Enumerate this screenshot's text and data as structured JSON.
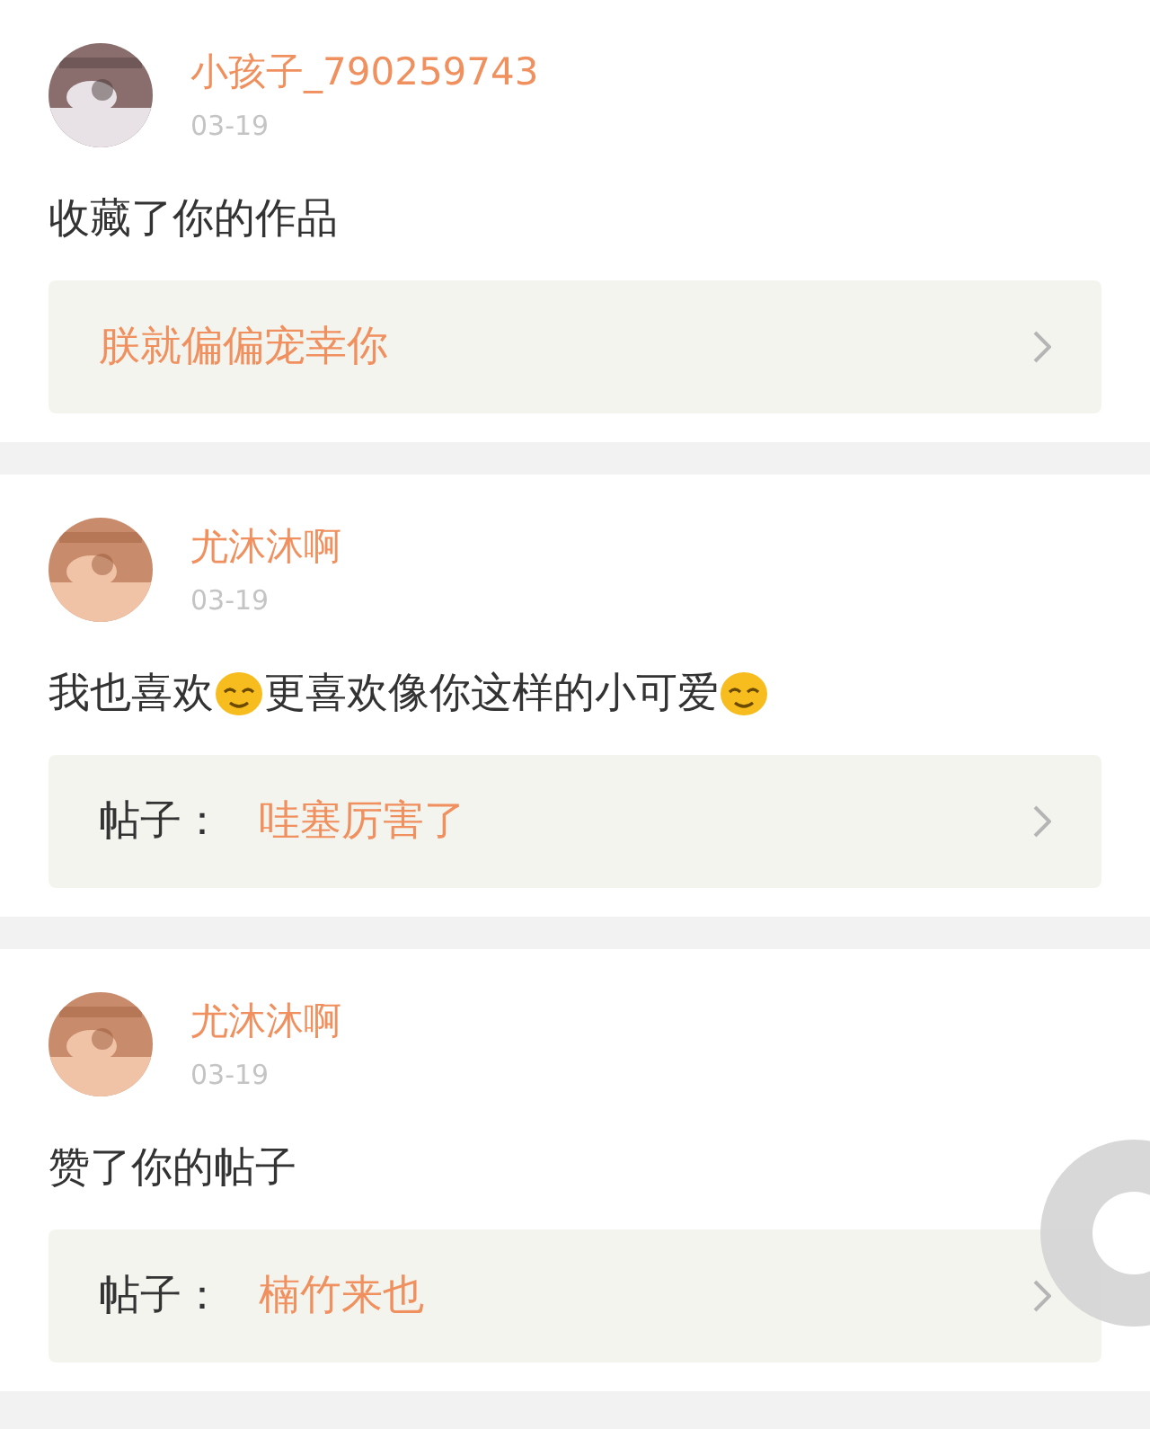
{
  "notifications": [
    {
      "username": "小孩子_790259743",
      "date": "03-19",
      "message": [
        {
          "kind": "text",
          "text": "收藏了你的作品"
        }
      ],
      "link": {
        "title": "朕就偏偏宠幸你"
      }
    },
    {
      "username": "尤沐沐啊",
      "date": "03-19",
      "message": [
        {
          "kind": "text",
          "text": "我也喜欢"
        },
        {
          "kind": "emoji"
        },
        {
          "kind": "text",
          "text": "更喜欢像你这样的小可爱"
        },
        {
          "kind": "emoji"
        }
      ],
      "link": {
        "label": "帖子：",
        "title": "哇塞厉害了"
      }
    },
    {
      "username": "尤沐沐啊",
      "date": "03-19",
      "message": [
        {
          "kind": "text",
          "text": "赞了你的帖子"
        }
      ],
      "link": {
        "label": "帖子：",
        "title": "楠竹来也"
      }
    }
  ]
}
